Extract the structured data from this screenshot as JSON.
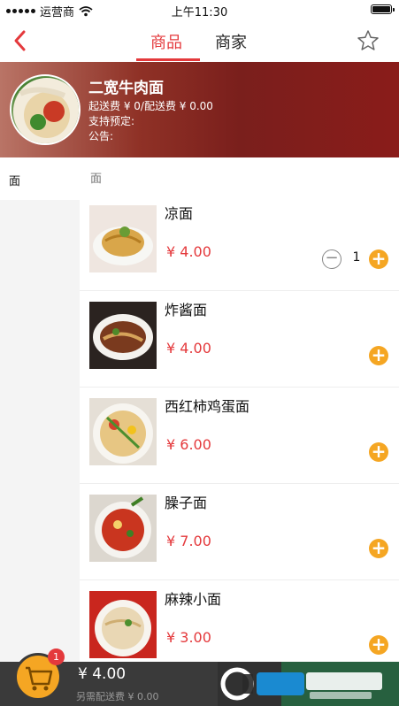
{
  "status_bar": {
    "carrier": "运营商",
    "time": "上午11:30"
  },
  "nav": {
    "tab_goods": "商品",
    "tab_shop": "商家"
  },
  "shop": {
    "name": "二宽牛肉面",
    "fee_line": "起送费 ¥ 0/配送费 ¥ 0.00",
    "reserve_line": "支持预定:",
    "notice_line": "公告:"
  },
  "sidebar": {
    "items": [
      {
        "label": "面"
      }
    ]
  },
  "section": {
    "title": "面"
  },
  "items": [
    {
      "name": "凉面",
      "price": "¥ 4.00",
      "quantity": "1"
    },
    {
      "name": "炸酱面",
      "price": "¥ 4.00"
    },
    {
      "name": "西红柿鸡蛋面",
      "price": "¥ 6.00"
    },
    {
      "name": "臊子面",
      "price": "¥ 7.00"
    },
    {
      "name": "麻辣小面",
      "price": "¥ 3.00"
    }
  ],
  "cart": {
    "badge": "1",
    "total": "¥ 4.00",
    "delivery_note": "另需配送费 ¥ 0.00"
  },
  "colors": {
    "accent": "#e4393c",
    "add_button": "#f5a623",
    "checkout": "#25a35a",
    "bottom_bar": "#3a3a3a"
  },
  "icons": [
    "back-arrow-icon",
    "star-icon",
    "cart-icon",
    "plus-icon",
    "minus-icon",
    "wifi-icon",
    "battery-icon"
  ]
}
